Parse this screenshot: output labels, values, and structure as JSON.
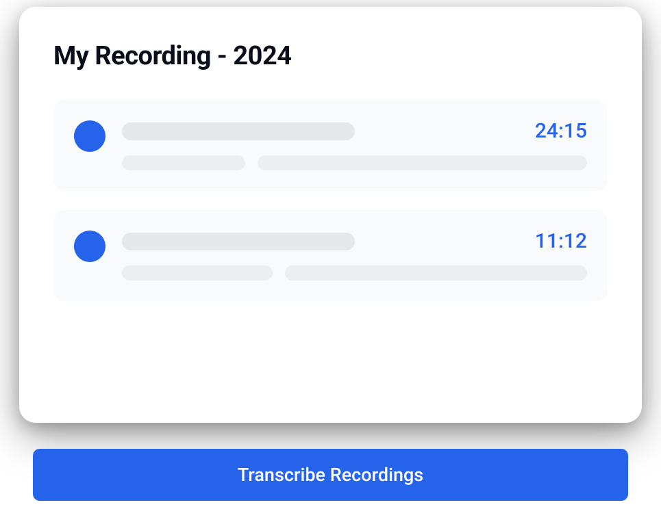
{
  "title": "My Recording - 2024",
  "recordings": [
    {
      "duration": "24:15"
    },
    {
      "duration": "11:12"
    }
  ],
  "transcribe_label": "Transcribe Recordings",
  "colors": {
    "accent": "#2563eb"
  }
}
